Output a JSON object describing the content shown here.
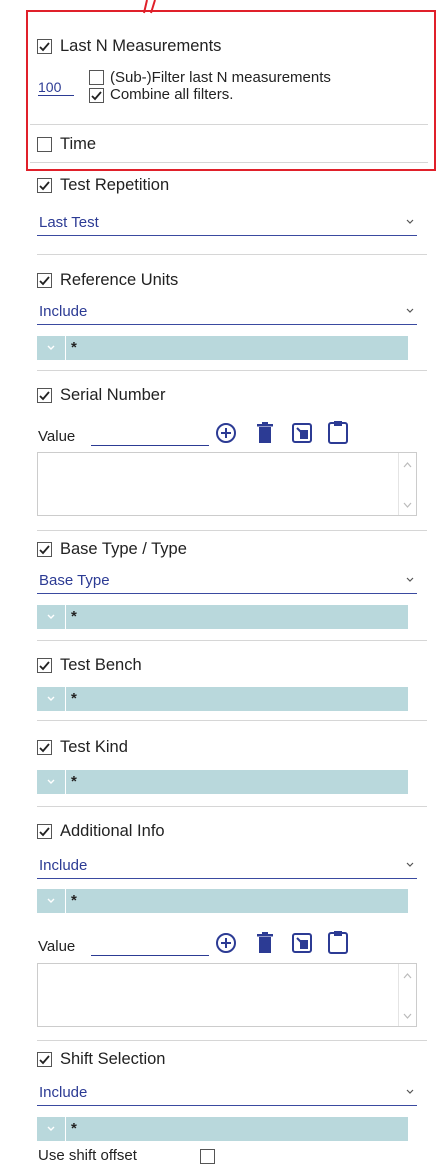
{
  "colors": {
    "highlight": "#e0202a",
    "accent": "#2c3b94",
    "chip_bg": "#b9d8dc"
  },
  "last_n": {
    "label": "Last N Measurements",
    "checked": true,
    "n_value": "100",
    "subfilter_label": "(Sub-)Filter last N measurements",
    "subfilter_checked": false,
    "combine_label": "Combine all filters.",
    "combine_checked": true
  },
  "time": {
    "label": "Time",
    "checked": false
  },
  "test_repetition": {
    "label": "Test Repetition",
    "checked": true,
    "select_value": "Last Test"
  },
  "reference_units": {
    "label": "Reference Units",
    "checked": true,
    "select_value": "Include",
    "chip": "*"
  },
  "serial_number": {
    "label": "Serial Number",
    "checked": true,
    "value_label": "Value"
  },
  "base_type": {
    "label": "Base Type / Type",
    "checked": true,
    "select_value": "Base Type",
    "chip": "*"
  },
  "test_bench": {
    "label": "Test Bench",
    "checked": true,
    "chip": "*"
  },
  "test_kind": {
    "label": "Test Kind",
    "checked": true,
    "chip": "*"
  },
  "additional_info": {
    "label": "Additional Info",
    "checked": true,
    "select_value": "Include",
    "chip": "*",
    "value_label": "Value"
  },
  "shift_selection": {
    "label": "Shift Selection",
    "checked": true,
    "select_value": "Include",
    "chip": "*"
  },
  "shift_offset": {
    "label": "Use shift offset",
    "checked": false
  }
}
